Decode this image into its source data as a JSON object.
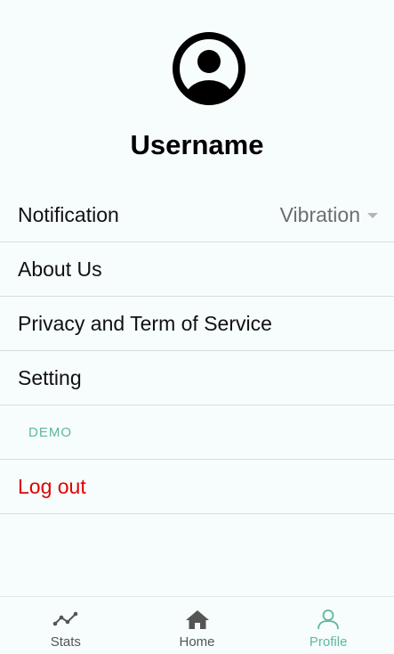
{
  "profile": {
    "username": "Username"
  },
  "menu": {
    "notification_label": "Notification",
    "notification_value": "Vibration",
    "about_label": "About Us",
    "privacy_label": "Privacy and Term of Service",
    "setting_label": "Setting",
    "demo_label": "DEMO",
    "logout_label": "Log out"
  },
  "tabs": {
    "stats": "Stats",
    "home": "Home",
    "profile": "Profile",
    "active": "Profile"
  },
  "colors": {
    "accent": "#5fb7a0",
    "danger": "#e10000",
    "background": "#f7fcfc"
  }
}
